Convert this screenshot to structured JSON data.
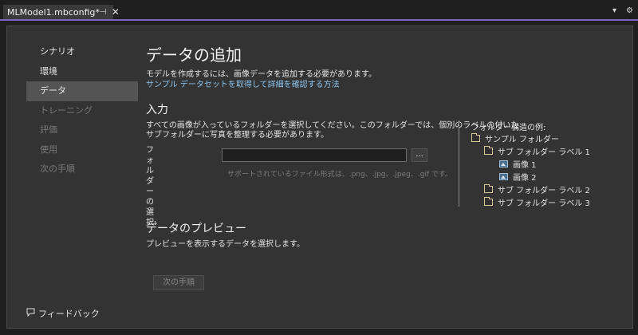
{
  "tab": {
    "title": "MLModel1.mbconfig*",
    "pin": "⊣",
    "close": "✕"
  },
  "toolbar": {
    "dropdown": "▾",
    "settings": "⚙"
  },
  "nav": {
    "items": [
      {
        "label": "シナリオ"
      },
      {
        "label": "環境"
      },
      {
        "label": "データ"
      },
      {
        "label": "トレーニング"
      },
      {
        "label": "評価"
      },
      {
        "label": "使用"
      },
      {
        "label": "次の手順"
      }
    ],
    "feedback": "フィードバック"
  },
  "content": {
    "title": "データの追加",
    "description": "モデルを作成するには、画像データを追加する必要があります。",
    "link": "サンプル データセットを取得して詳細を確認する方法",
    "input": {
      "heading": "入力",
      "line1": "すべての画像が入っているフォルダーを選択してください。このフォルダーでは、個別のラベルの付いた",
      "line2": "サブフォルダーに写真を整理する必要があります。",
      "folder_label_1": "フォルダーの選",
      "folder_label_2": "択:",
      "folder_value": "",
      "browse": "...",
      "formats": "サポートされているファイル形式は、.png、.jpg、.jpeg、.gif です。"
    },
    "example": {
      "title": "フォルダー構造の例:",
      "tree": [
        {
          "label": "サンプル フォルダー",
          "icon": "folder-icon"
        },
        {
          "label": "サブ フォルダー ラベル 1",
          "icon": "folder-icon"
        },
        {
          "label": "画像 1",
          "icon": "image-icon"
        },
        {
          "label": "画像 2",
          "icon": "image-icon"
        },
        {
          "label": "サブ フォルダー ラベル 2",
          "icon": "folder-icon"
        },
        {
          "label": "サブ フォルダー ラベル 3",
          "icon": "folder-icon"
        }
      ]
    },
    "preview": {
      "heading": "データのプレビュー",
      "text": "プレビューを表示するデータを選択します。"
    },
    "next_button": "次の手順"
  },
  "colors": {
    "accent": "#7a63c9",
    "link": "#8cc3ec",
    "panel": "#333333"
  }
}
